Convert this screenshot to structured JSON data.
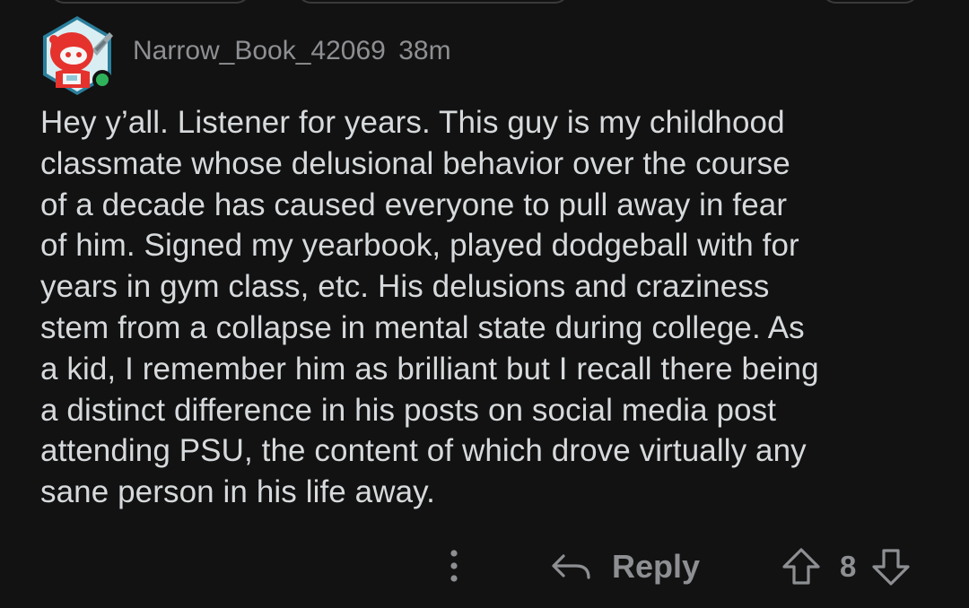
{
  "comment": {
    "author": "Narrow_Book_42069",
    "age": "38m",
    "body": "Hey y’all. Listener for years. This guy is my childhood\nclassmate whose delusional behavior over the course\nof a decade has caused everyone to pull away in fear\nof him.  Signed my yearbook, played dodgeball with for\nyears in gym class, etc. His delusions and craziness\nstem from a collapse in mental state during college. As\na kid, I remember him as brilliant but I recall there being\na distinct difference in his posts on social media post\nattending PSU, the content of which drove virtually any\nsane person in his life away.",
    "online_status_color": "#2fb35a"
  },
  "actions": {
    "more_icon": "more-vertical-icon",
    "reply_icon": "reply-arrow-icon",
    "reply_label": "Reply",
    "upvote_icon": "upvote-arrow-icon",
    "vote_count": "8",
    "downvote_icon": "downvote-arrow-icon"
  },
  "colors": {
    "background": "#121212",
    "text": "#d7dadc",
    "muted": "#8d8f92",
    "avatar_red": "#e5322d"
  }
}
